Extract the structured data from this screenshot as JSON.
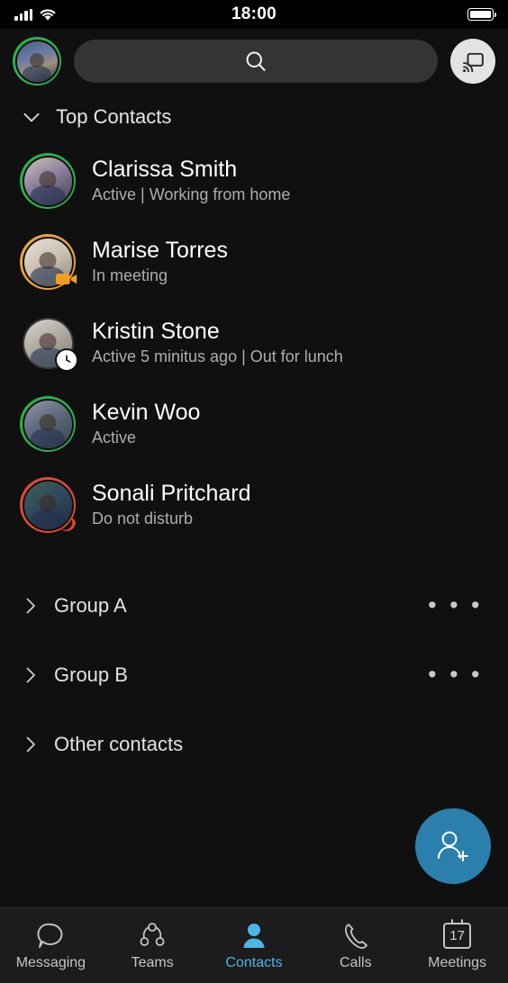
{
  "status_bar": {
    "time": "18:00",
    "signal_icon": "cellular-bars-icon",
    "wifi_icon": "wifi-icon",
    "battery_icon": "battery-full-icon"
  },
  "top_bar": {
    "profile_avatar_name": "profile-avatar",
    "profile_presence": "available",
    "search_placeholder": "",
    "search_icon": "search-icon",
    "cast_icon": "cast-screen-share-icon"
  },
  "sections": {
    "top_contacts": {
      "label": "Top Contacts",
      "expanded": true,
      "chevron": "chevron-down-icon"
    }
  },
  "contacts": [
    {
      "name": "Clarissa Smith",
      "status": "Active | Working from home",
      "presence": "available",
      "ring_color": "#2bb14a",
      "badge": "none"
    },
    {
      "name": "Marise Torres",
      "status": "In meeting",
      "presence": "in-meeting",
      "ring_color": "#e8a33d",
      "badge": "video-camera-icon"
    },
    {
      "name": "Kristin Stone",
      "status": "Active 5 minitus ago | Out for lunch",
      "presence": "away",
      "ring_color": "none",
      "badge": "clock-icon"
    },
    {
      "name": "Kevin Woo",
      "status": "Active",
      "presence": "available",
      "ring_color": "#2bb14a",
      "badge": "none"
    },
    {
      "name": "Sonali Pritchard",
      "status": "Do not disturb",
      "presence": "do-not-disturb",
      "ring_color": "#e04b34",
      "badge": "dnd-icon"
    }
  ],
  "groups": [
    {
      "label": "Group A",
      "chevron": "chevron-right-icon",
      "overflow": "• • •",
      "has_overflow": true
    },
    {
      "label": "Group B",
      "chevron": "chevron-right-icon",
      "overflow": "• • •",
      "has_overflow": true
    },
    {
      "label": "Other contacts",
      "chevron": "chevron-right-icon",
      "overflow": "",
      "has_overflow": false
    }
  ],
  "fab": {
    "icon": "add-person-icon",
    "color": "#2b7fad",
    "label": ""
  },
  "bottom_nav": {
    "active": "Contacts",
    "active_color": "#4db4e8",
    "items": [
      {
        "label": "Messaging",
        "icon": "chat-bubble-icon"
      },
      {
        "label": "Teams",
        "icon": "teams-icon"
      },
      {
        "label": "Contacts",
        "icon": "person-icon"
      },
      {
        "label": "Calls",
        "icon": "phone-handset-icon"
      },
      {
        "label": "Meetings",
        "icon": "calendar-icon",
        "day": "17"
      }
    ]
  }
}
